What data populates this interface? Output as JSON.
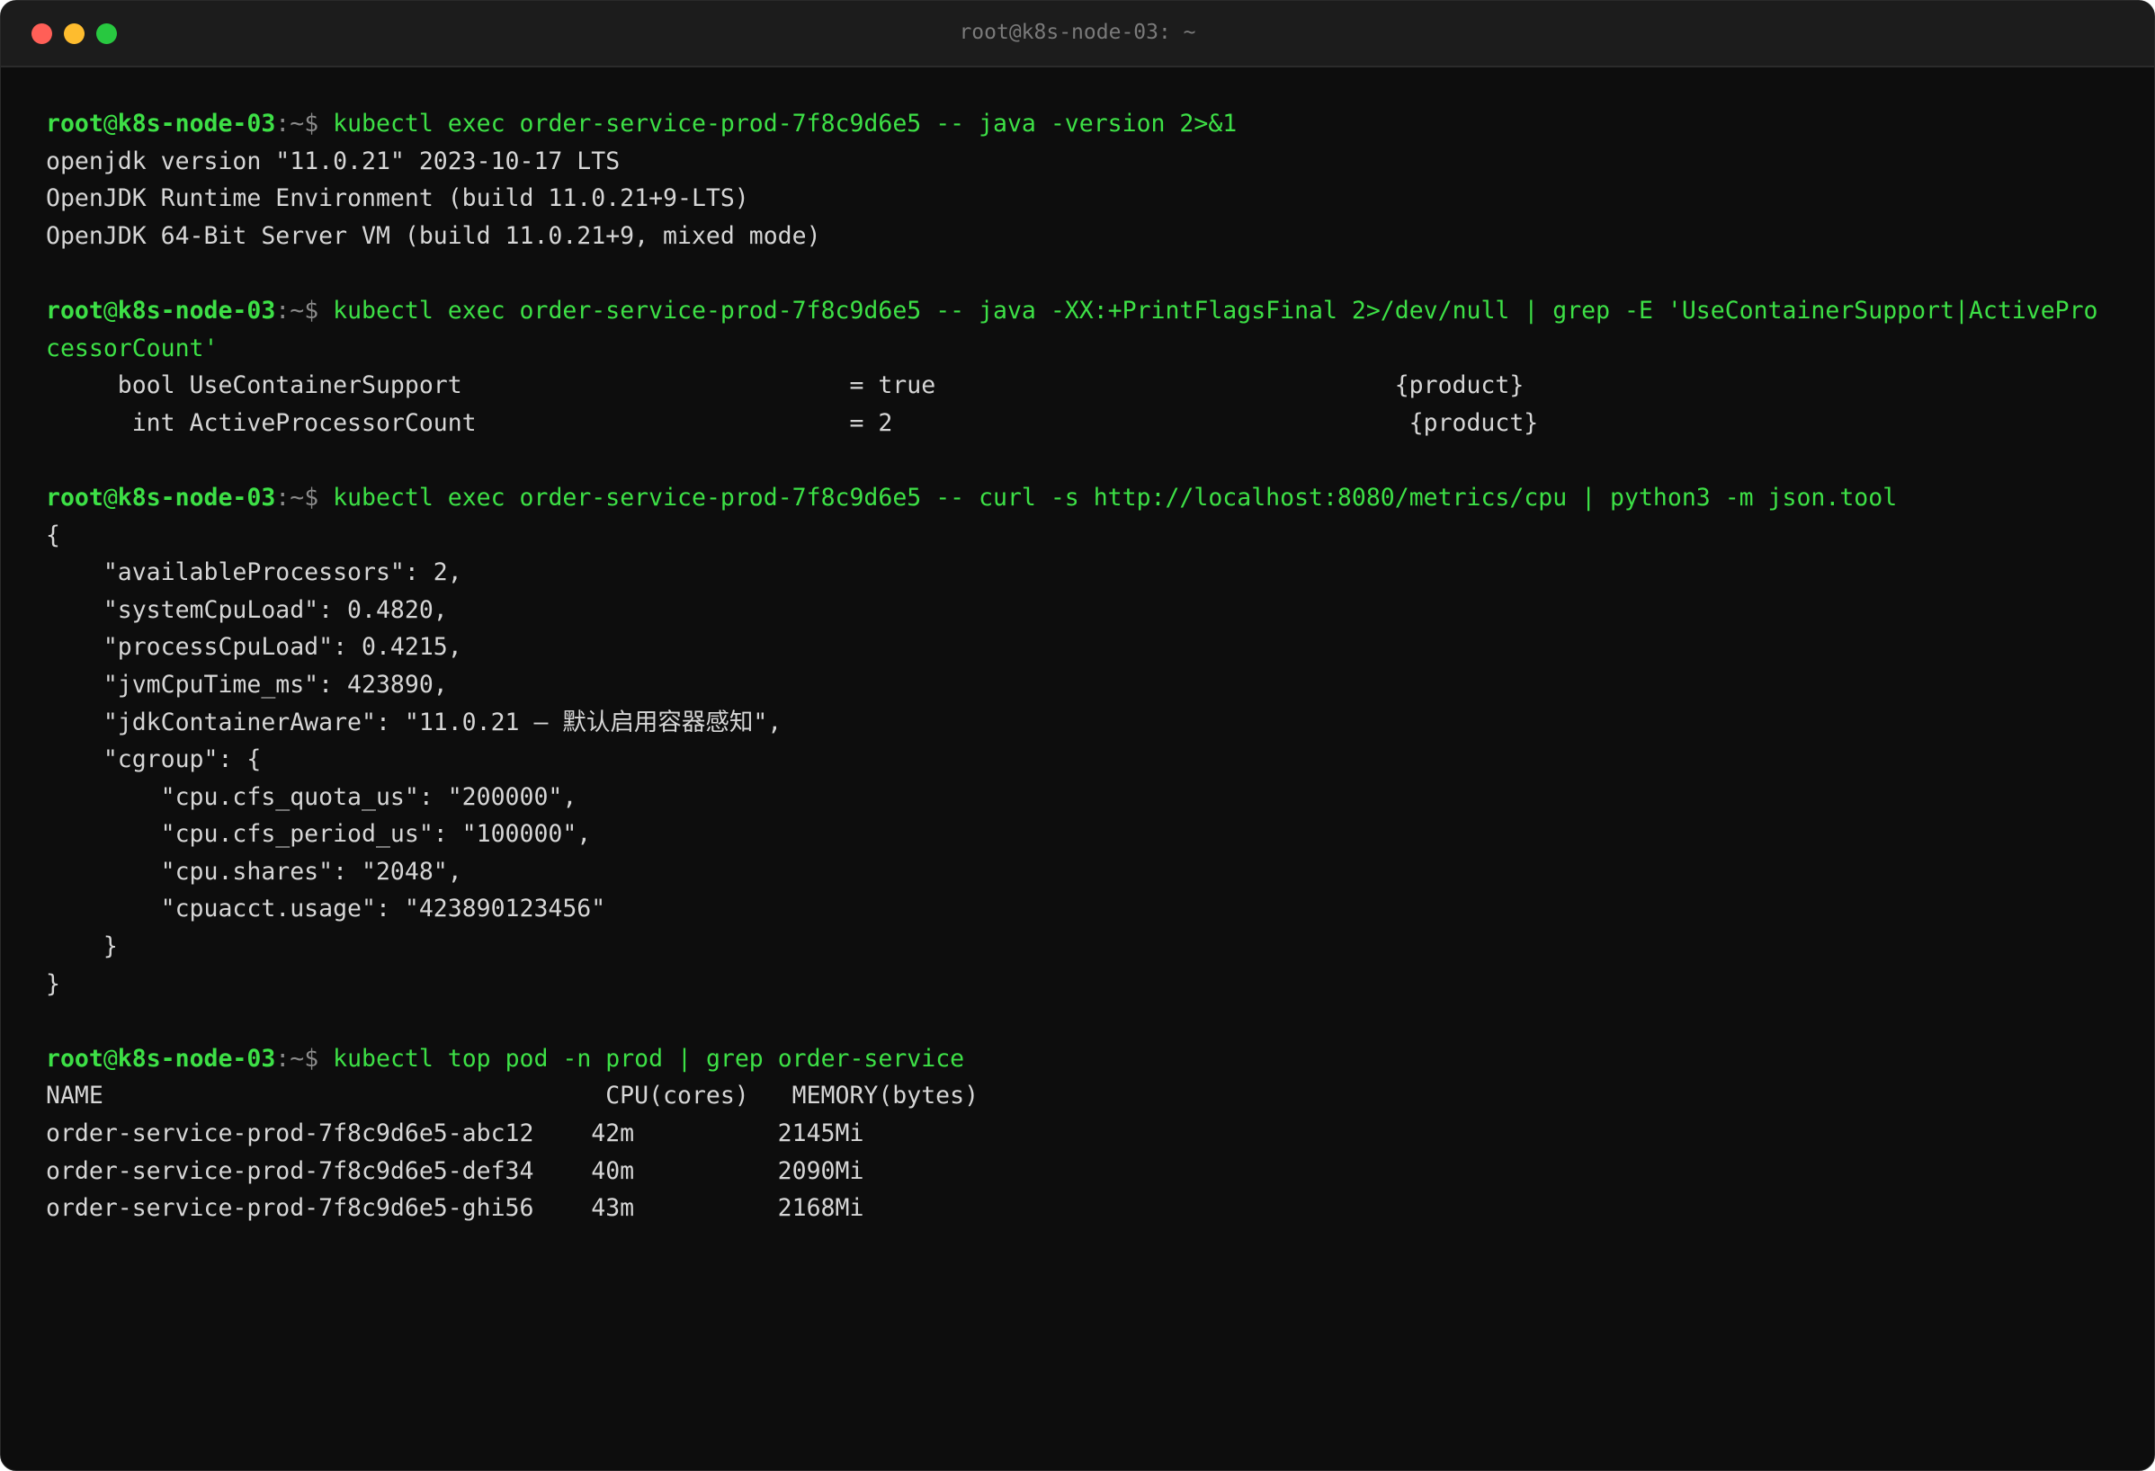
{
  "window": {
    "title": "root@k8s-node-03: ~"
  },
  "prompt": {
    "user": "root",
    "at": "@",
    "host": "k8s-node-03",
    "path": ":~$ "
  },
  "blocks": [
    {
      "command": "kubectl exec order-service-prod-7f8c9d6e5 -- java -version 2>&1",
      "output": [
        "openjdk version \"11.0.21\" 2023-10-17 LTS",
        "OpenJDK Runtime Environment (build 11.0.21+9-LTS)",
        "OpenJDK 64-Bit Server VM (build 11.0.21+9, mixed mode)"
      ]
    },
    {
      "command": "kubectl exec order-service-prod-7f8c9d6e5 -- java -XX:+PrintFlagsFinal 2>/dev/null | grep -E 'UseContainerSupport|ActivePro",
      "command_wrap": "cessorCount'",
      "output": [
        "     bool UseContainerSupport                           = true                                {product}",
        "      int ActiveProcessorCount                          = 2                                    {product}"
      ]
    },
    {
      "command": "kubectl exec order-service-prod-7f8c9d6e5 -- curl -s http://localhost:8080/metrics/cpu | python3 -m json.tool",
      "output": [
        "{",
        "    \"availableProcessors\": 2,",
        "    \"systemCpuLoad\": 0.4820,",
        "    \"processCpuLoad\": 0.4215,",
        "    \"jvmCpuTime_ms\": 423890,",
        "    \"jdkContainerAware\": \"11.0.21 — 默认启用容器感知\",",
        "    \"cgroup\": {",
        "        \"cpu.cfs_quota_us\": \"200000\",",
        "        \"cpu.cfs_period_us\": \"100000\",",
        "        \"cpu.shares\": \"2048\",",
        "        \"cpuacct.usage\": \"423890123456\"",
        "    }",
        "}"
      ]
    },
    {
      "command": "kubectl top pod -n prod | grep order-service",
      "output": [
        "NAME                                   CPU(cores)   MEMORY(bytes)",
        "order-service-prod-7f8c9d6e5-abc12    42m          2145Mi",
        "order-service-prod-7f8c9d6e5-def34    40m          2090Mi",
        "order-service-prod-7f8c9d6e5-ghi56    43m          2168Mi"
      ]
    }
  ]
}
